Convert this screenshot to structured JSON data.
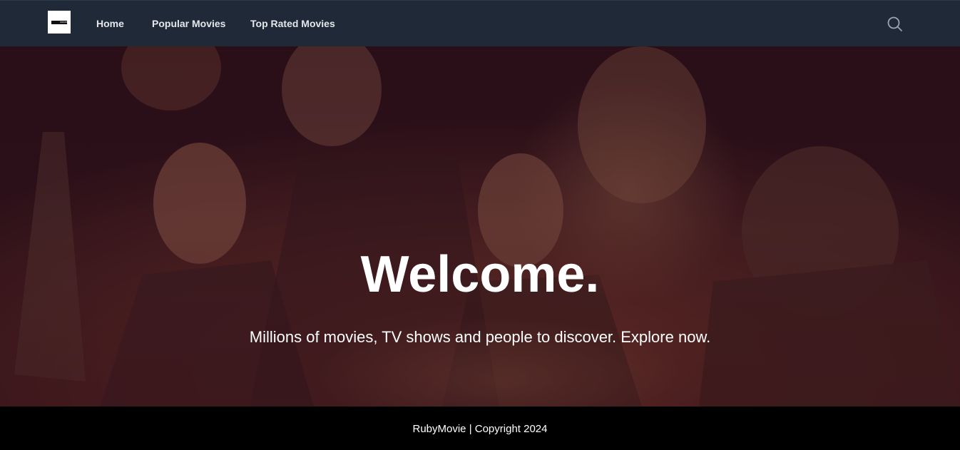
{
  "nav": {
    "logo_text": "MOVIE",
    "links": [
      {
        "label": "Home"
      },
      {
        "label": "Popular Movies"
      },
      {
        "label": "Top Rated Movies"
      }
    ],
    "search_icon": "search-icon"
  },
  "hero": {
    "title": "Welcome.",
    "subtitle": "Millions of movies, TV shows and people to discover. Explore now."
  },
  "footer": {
    "text": "RubyMovie | Copyright 2024"
  },
  "colors": {
    "navbar_bg": "#1f2937",
    "hero_tint": "#3a1a1c",
    "footer_bg": "#000000",
    "text": "#ffffff"
  }
}
